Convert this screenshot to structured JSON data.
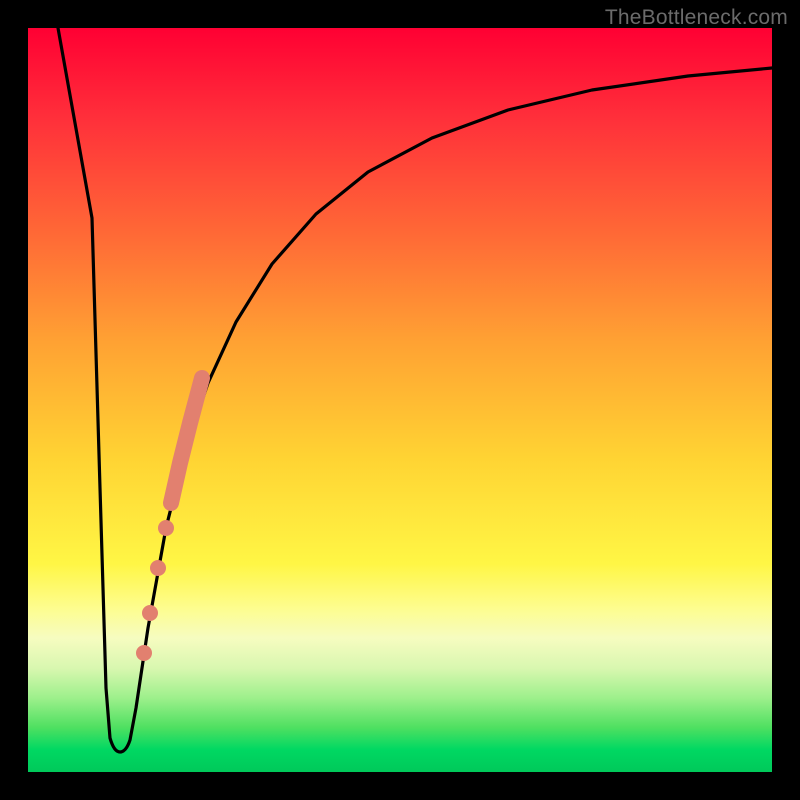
{
  "watermark": "TheBottleneck.com",
  "colors": {
    "curve": "#000000",
    "markers": "#e2806f",
    "frame": "#000000"
  },
  "chart_data": {
    "type": "line",
    "title": "",
    "xlabel": "",
    "ylabel": "",
    "xlim": [
      0,
      100
    ],
    "ylim": [
      0,
      100
    ],
    "note": "Axes are unlabeled; values are estimated from pixel positions on a 0-100 normalized scale where y=0 is the bottom edge and y=100 is the top edge of the plot area.",
    "series": [
      {
        "name": "bottleneck-curve",
        "x": [
          4,
          6,
          8,
          9,
          10,
          11,
          12,
          13,
          14,
          16,
          18,
          20,
          22,
          25,
          28,
          32,
          36,
          42,
          50,
          60,
          72,
          86,
          100
        ],
        "y": [
          100,
          75,
          40,
          12,
          4,
          3,
          3,
          4,
          8,
          20,
          32,
          42,
          50,
          58,
          65,
          72,
          77,
          82,
          86.5,
          90,
          92.5,
          94.2,
          95.4
        ]
      }
    ],
    "markers": {
      "name": "highlighted-range",
      "description": "Thick salmon segment plus discrete dots along the ascending limb of the curve.",
      "thick_segment": {
        "x_start": 18,
        "x_end": 22,
        "approximate": true
      },
      "points": [
        {
          "x": 17.5,
          "y": 29
        },
        {
          "x": 16.4,
          "y": 24
        },
        {
          "x": 15.4,
          "y": 18
        },
        {
          "x": 14.6,
          "y": 13
        }
      ]
    }
  }
}
